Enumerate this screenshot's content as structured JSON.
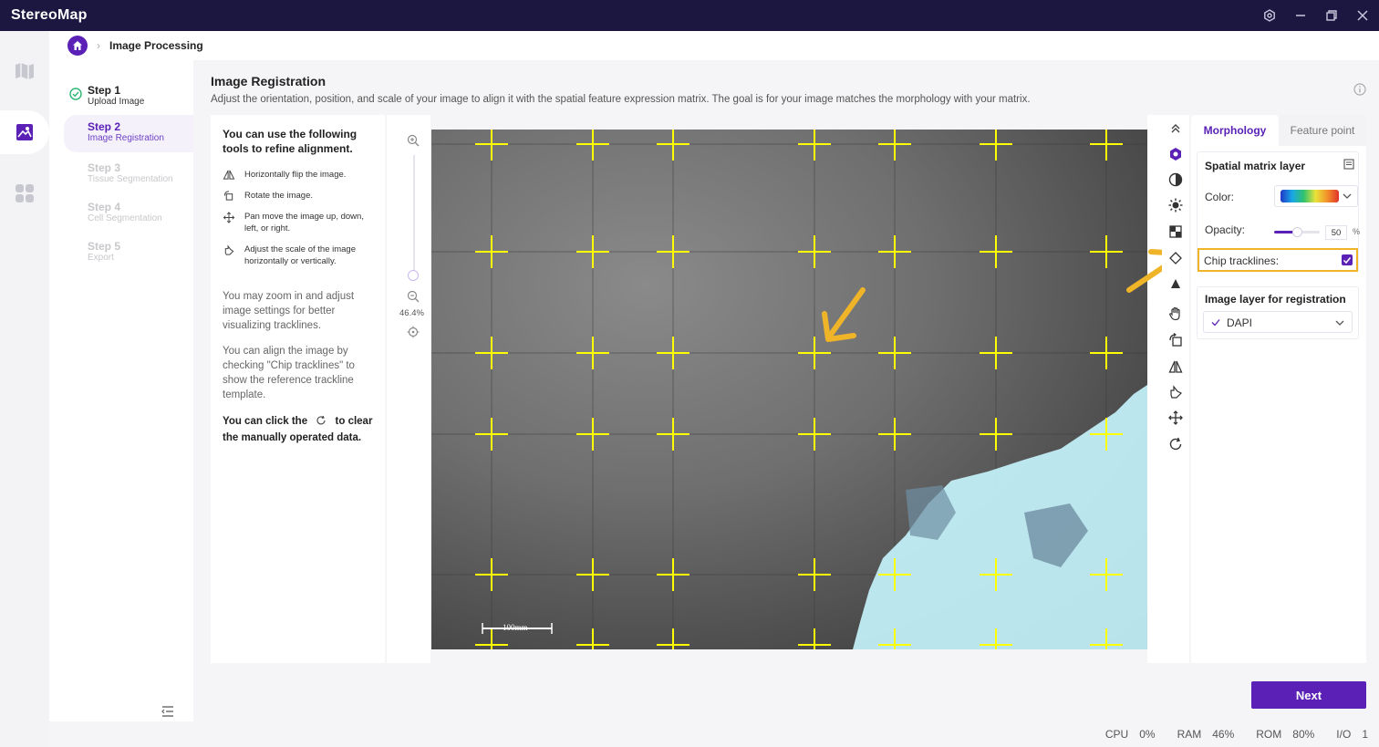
{
  "app": {
    "title": "StereoMap"
  },
  "breadcrumb": {
    "current": "Image Processing"
  },
  "steps": [
    {
      "title": "Step 1",
      "subtitle": "Upload Image",
      "state": "done"
    },
    {
      "title": "Step 2",
      "subtitle": "Image Registration",
      "state": "active"
    },
    {
      "title": "Step 3",
      "subtitle": "Tissue Segmentation",
      "state": "pending"
    },
    {
      "title": "Step 4",
      "subtitle": "Cell Segmentation",
      "state": "pending"
    },
    {
      "title": "Step 5",
      "subtitle": "Export",
      "state": "pending"
    }
  ],
  "main": {
    "title": "Image Registration",
    "description": "Adjust the orientation, position, and scale of your image to align it with the spatial feature expression matrix. The goal is for your image matches the morphology with your matrix."
  },
  "instructions": {
    "lead": "You can use the following tools to refine alignment.",
    "tools": [
      {
        "icon": "flip-icon",
        "text": "Horizontally flip the image."
      },
      {
        "icon": "rotate-icon",
        "text": "Rotate the image."
      },
      {
        "icon": "move-icon",
        "text": "Pan move the image up, down, left, or right."
      },
      {
        "icon": "scale-icon",
        "text": "Adjust the scale of the image horizontally or vertically."
      }
    ],
    "para1": "You may zoom in and adjust image settings for better visualizing tracklines.",
    "para2": "You can align the image by checking \"Chip tracklines\" to show the reference trackline template.",
    "para3_a": "You can click the",
    "para3_b": "to clear the manually operated data."
  },
  "zoom": {
    "level": "46.4%"
  },
  "image": {
    "scalebar_label": "100mm"
  },
  "panel": {
    "tabs": [
      "Morphology",
      "Feature point"
    ],
    "active_tab": 0,
    "spatial_layer": {
      "title": "Spatial matrix layer",
      "color_label": "Color:",
      "opacity_label": "Opacity:",
      "opacity_value": "50",
      "opacity_unit": "%",
      "chip_tracklines_label": "Chip tracklines:",
      "chip_tracklines_checked": true
    },
    "registration_layer": {
      "title": "Image layer for registration",
      "selected": "DAPI"
    }
  },
  "next_label": "Next",
  "status": {
    "cpu_label": "CPU",
    "cpu_value": "0%",
    "ram_label": "RAM",
    "ram_value": "46%",
    "rom_label": "ROM",
    "rom_value": "80%",
    "io_label": "I/O",
    "io_value": "1"
  },
  "colors": {
    "accent": "#5b21b6",
    "titlebar": "#1b1740",
    "trackline": "#ffff00",
    "highlight": "#f0b429"
  }
}
